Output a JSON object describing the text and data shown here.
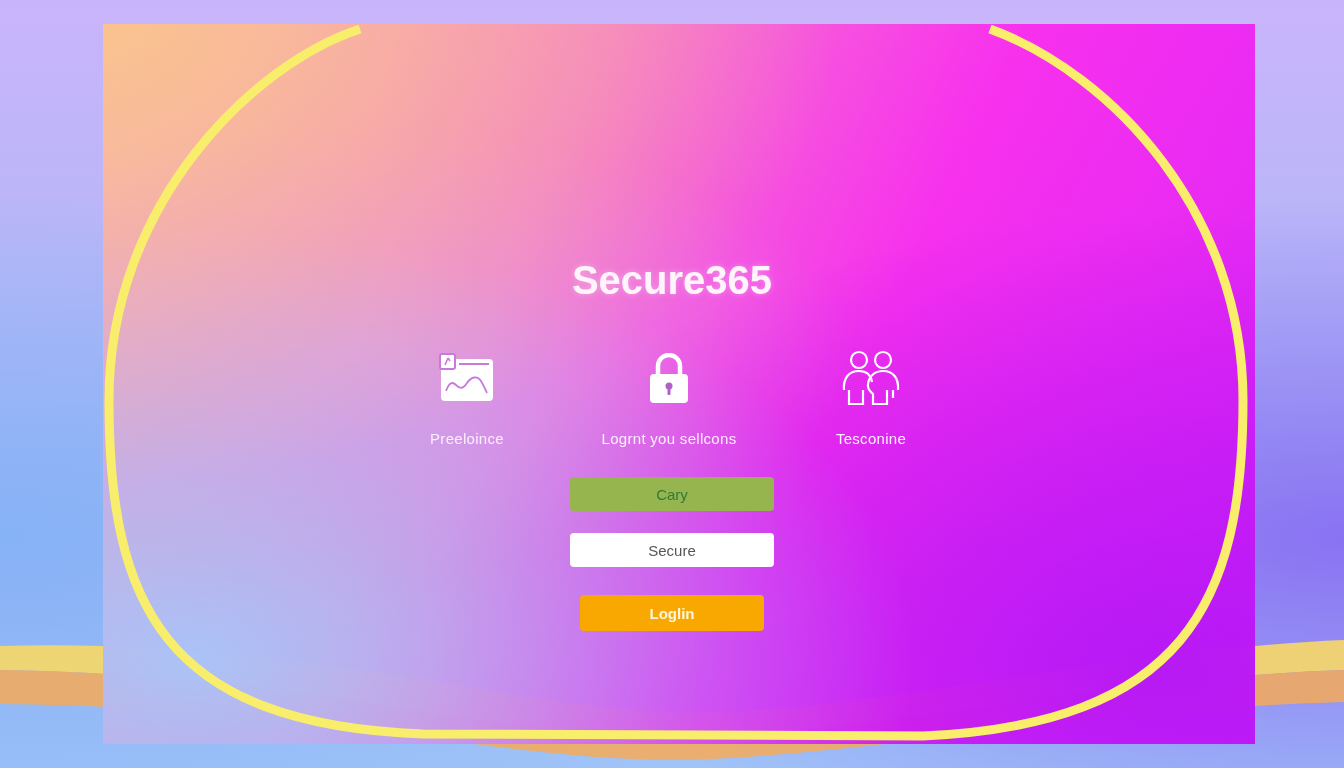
{
  "app": {
    "title": "Secure365"
  },
  "features": [
    {
      "kind": "chart",
      "label": "Preeloince"
    },
    {
      "kind": "padlock",
      "label": "Logrnt you sellcons"
    },
    {
      "kind": "people",
      "label": "Tesconine"
    }
  ],
  "form": {
    "fields": [
      {
        "kind": "highlighted",
        "value": "Cary"
      },
      {
        "kind": "plain",
        "value": "Secure"
      }
    ],
    "login_button": {
      "label": "Loglin"
    }
  }
}
